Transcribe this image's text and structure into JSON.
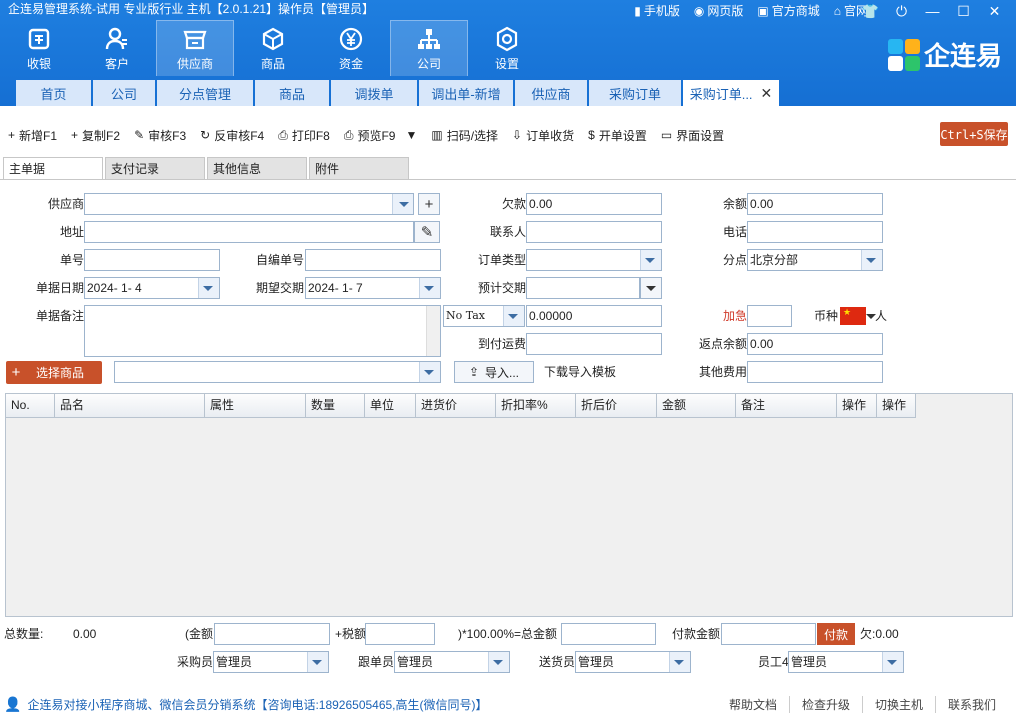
{
  "window": {
    "title": "企连易管理系统-试用 专业版行业 主机【2.0.1.21】操作员【管理员】",
    "top_links": [
      "手机版",
      "网页版",
      "官方商城",
      "官网"
    ]
  },
  "modules": [
    {
      "label": "收银",
      "icon": "cashier-icon"
    },
    {
      "label": "客户",
      "icon": "customer-icon"
    },
    {
      "label": "供应商",
      "icon": "supplier-icon"
    },
    {
      "label": "商品",
      "icon": "goods-icon"
    },
    {
      "label": "资金",
      "icon": "yen-icon"
    },
    {
      "label": "公司",
      "icon": "org-icon"
    },
    {
      "label": "设置",
      "icon": "settings-icon"
    }
  ],
  "brand": {
    "name": "企连易"
  },
  "tabs": [
    "首页",
    "公司",
    "分点管理",
    "商品",
    "调拨单",
    "调出单-新增",
    "供应商",
    "采购订单",
    "采购订单..."
  ],
  "toolbar": {
    "items": [
      "新增F1",
      "复制F2",
      "审核F3",
      "反审核F4",
      "打印F8",
      "预览F9",
      "扫码/选择",
      "订单收货",
      "开单设置",
      "界面设置"
    ],
    "save": "Ctrl+S保存"
  },
  "subtabs": [
    "主单据",
    "支付记录",
    "其他信息",
    "附件"
  ],
  "form": {
    "supplier_label": "供应商",
    "supplier": "",
    "address_label": "地址",
    "address": "",
    "docno_label": "单号",
    "docno": "",
    "selfno_label": "自编单号",
    "selfno": "",
    "date_label": "单据日期",
    "date": "2024- 1- 4",
    "expected_label": "期望交期",
    "expected": "2024- 1- 7",
    "remark_label": "单据备注",
    "remark": "",
    "owed_label": "欠款",
    "owed": "0.00",
    "contact_label": "联系人",
    "contact": "",
    "ordertype_label": "订单类型",
    "ordertype": "",
    "estimate_label": "预计交期",
    "estimate": "",
    "tax_option": "No Tax",
    "tax_value": "0.00000",
    "freight_label": "到付运费",
    "freight": "",
    "balance_label": "余额",
    "balance": "0.00",
    "phone_label": "电话",
    "phone": "",
    "branch_label": "分点",
    "branch": "北京分部",
    "urgent_label": "加急",
    "urgent": "",
    "currency_label": "币种",
    "currency_tail": "人",
    "rebate_label": "返点余额",
    "rebate": "0.00",
    "other_label": "其他费用",
    "other": "",
    "select_goods": "选择商品",
    "goods_search": "",
    "import": "导入...",
    "template": "下载导入模板"
  },
  "grid": {
    "columns": [
      "No.",
      "品名",
      "属性",
      "数量",
      "单位",
      "进货价",
      "折扣率%",
      "折后价",
      "金额",
      "备注",
      "操作",
      "操作"
    ]
  },
  "footer": {
    "total_qty_label": "总数量:",
    "total_qty": "0.00",
    "amount_label": "(金额",
    "amount": "",
    "tax_label": "+税额",
    "tax": "",
    "total_label": ")*100.00%=总金额",
    "total": "",
    "pay_amount_label": "付款金额",
    "pay_amount": "",
    "pay_button": "付款",
    "owe": "欠:0.00",
    "buyer_label": "采购员",
    "buyer": "管理员",
    "follower_label": "跟单员",
    "follower": "管理员",
    "shipper_label": "送货员",
    "shipper": "管理员",
    "staff_label": "员工4",
    "staff": "管理员"
  },
  "status": {
    "promo": "企连易对接小程序商城、微信会员分销系统【咨询电话:18926505465,高生(微信同号)】",
    "links": [
      "帮助文档",
      "检查升级",
      "切换主机",
      "联系我们"
    ]
  },
  "colors": {
    "header": "#1a76dc",
    "accent": "#c8512a",
    "urgent": "#d03a2a"
  }
}
